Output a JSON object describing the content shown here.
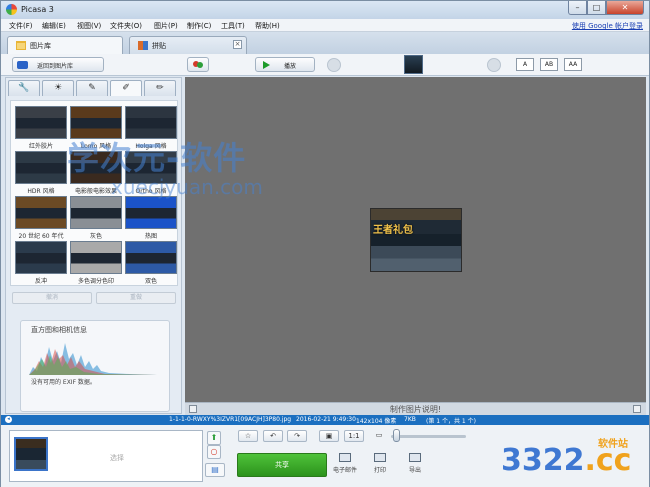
{
  "window": {
    "title": "Picasa 3",
    "min": "–",
    "max": "□",
    "close": "✕"
  },
  "menu": {
    "items": [
      "文件(F)",
      "编辑(E)",
      "视图(V)",
      "文件夹(O)",
      "图片(P)",
      "制作(C)",
      "工具(T)",
      "帮助(H)"
    ],
    "signin": "使用 Google 帐户登录"
  },
  "tabs": [
    {
      "label": "图片库"
    },
    {
      "label": "拼贴"
    }
  ],
  "toolbar": {
    "back_label": "返回到图片库",
    "play_label": "播放",
    "text_sizes": [
      "A",
      "AB",
      "AA"
    ]
  },
  "effects": [
    {
      "label": "红外胶片",
      "color": "#3a3f47"
    },
    {
      "label": "Lomo 风格",
      "color": "#5a3a1c"
    },
    {
      "label": "Holga 风格",
      "color": "#2c3540"
    },
    {
      "label": "HDR 风格",
      "color": "#2d3a46"
    },
    {
      "label": "电影般电影效果",
      "color": "#3a2a1f"
    },
    {
      "label": "Ortho 风格",
      "color": "#323d49"
    },
    {
      "label": "20 世纪 60 年代",
      "color": "#6b4a25"
    },
    {
      "label": "灰色",
      "color": "#8a8f95"
    },
    {
      "label": "热图",
      "color": "#1b53c8"
    },
    {
      "label": "反冲",
      "color": "#2b3b4c"
    },
    {
      "label": "多色调分色印",
      "color": "#a9a9a9"
    },
    {
      "label": "双色",
      "color": "#2d5aa6"
    }
  ],
  "left": {
    "undo": "撤消",
    "redo": "重做",
    "hist_title": "直方图和相机信息",
    "hist_msg": "没有可用的 EXIF 数据。"
  },
  "image": {
    "text": "王者礼包"
  },
  "caption": {
    "text": "制作图片说明!"
  },
  "status": {
    "filename": "1-1-1-0-RWXY%3IZVR1[09ACJH]3P80.jpg",
    "date": "2016-02-21 9:49:30",
    "dims": "142x104 像素",
    "size": "7KB",
    "position": "(第 1 个，共 1 个)"
  },
  "tray": {
    "hint": "选择",
    "share_label": "共享",
    "actions": [
      "电子邮件",
      "打印",
      "导出"
    ]
  },
  "watermark": {
    "line1": "学次元-软件",
    "line2": "xuecjyuan.com",
    "brand": "3322",
    "brand_suffix": ".cc",
    "brand_tag": "软件站"
  }
}
